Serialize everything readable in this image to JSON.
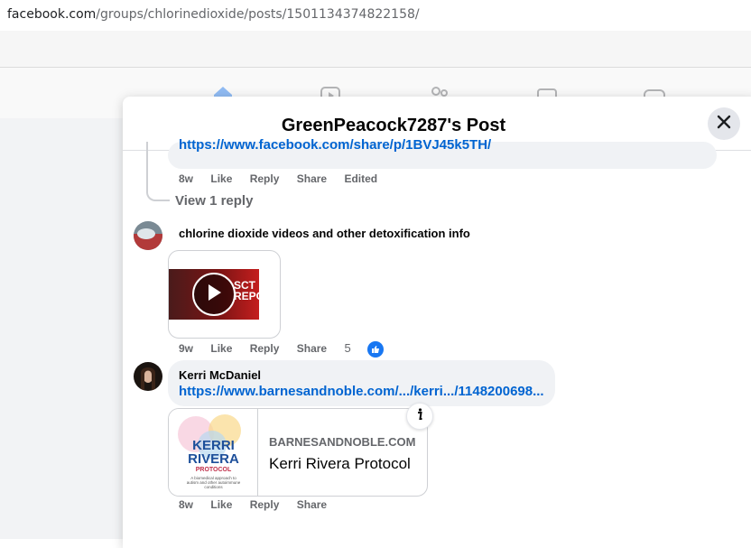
{
  "browser": {
    "url_domain": "facebook.com",
    "url_path": "/groups/chlorinedioxide/posts/1501134374822158/"
  },
  "nav": {
    "icons": [
      "home-icon",
      "video-icon",
      "groups-icon",
      "marketplace-icon",
      "gaming-icon"
    ]
  },
  "modal": {
    "title": "GreenPeacock7287's Post",
    "close_icon": "close-icon"
  },
  "comments": [
    {
      "link": "https://www.facebook.com/share/p/1BVJ45k5TH/",
      "time": "8w",
      "like": "Like",
      "reply": "Reply",
      "share": "Share",
      "edited": "Edited",
      "view_replies": "View 1 reply"
    },
    {
      "author": "chlorine dioxide videos and other detoxification info",
      "time": "9w",
      "like": "Like",
      "reply": "Reply",
      "share": "Share",
      "reaction_count": "5",
      "video_thumb_text": "SCT REPORT"
    },
    {
      "author": "Kerri McDaniel",
      "link": "https://www.barnesandnoble.com/.../kerri.../1148200698...",
      "card_domain": "BARNESANDNOBLE.COM",
      "card_title": "Kerri Rivera Protocol",
      "book_title_line1": "KERRI",
      "book_title_line2": "RIVERA",
      "book_title_line3": "PROTOCOL",
      "book_subtitle": "A biomedical approach to autism and other autoimmune conditions",
      "time": "8w",
      "like": "Like",
      "reply": "Reply",
      "share": "Share"
    }
  ],
  "colors": {
    "link": "#0064d1",
    "accent": "#1877f2",
    "bubble": "#f0f2f5",
    "meta_text": "#65676b"
  }
}
